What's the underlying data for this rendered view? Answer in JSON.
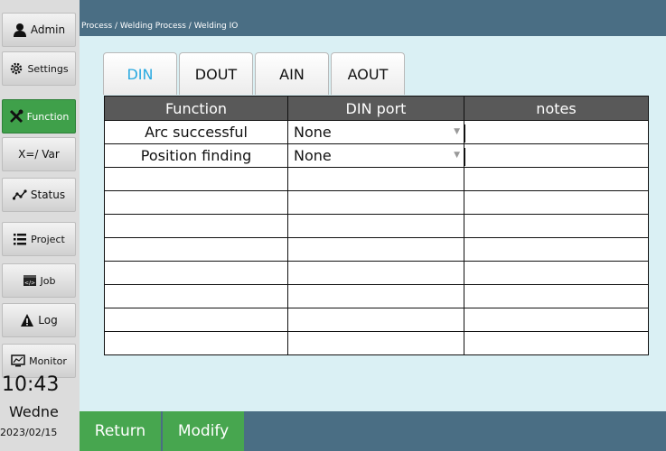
{
  "sidebar": {
    "items": [
      {
        "label": "Admin",
        "icon": "user-icon"
      },
      {
        "label": "Settings",
        "icon": "gear-icon"
      },
      {
        "label": "Function",
        "icon": "tools-icon"
      },
      {
        "label": "X=/ Var",
        "icon": ""
      },
      {
        "label": "Status",
        "icon": "waveform-icon"
      },
      {
        "label": "Project",
        "icon": "list-icon"
      },
      {
        "label": "Job",
        "icon": "code-icon"
      },
      {
        "label": "Log",
        "icon": "warning-icon"
      },
      {
        "label": "Monitor",
        "icon": "monitor-icon"
      }
    ],
    "time": "10:43",
    "day": "Wedne",
    "date": "2023/02/15"
  },
  "header": {
    "breadcrumb": "Process / Welding Process / Welding IO"
  },
  "tabs": [
    "DIN",
    "DOUT",
    "AIN",
    "AOUT"
  ],
  "active_tab": "DIN",
  "table": {
    "headers": [
      "Function",
      "DIN port",
      "notes"
    ],
    "rows": [
      [
        "Arc successful",
        "None",
        ""
      ],
      [
        "Position finding",
        "None",
        ""
      ],
      [
        "",
        "",
        ""
      ],
      [
        "",
        "",
        ""
      ],
      [
        "",
        "",
        ""
      ],
      [
        "",
        "",
        ""
      ],
      [
        "",
        "",
        ""
      ],
      [
        "",
        "",
        ""
      ],
      [
        "",
        "",
        ""
      ],
      [
        "",
        "",
        ""
      ]
    ]
  },
  "bottom": {
    "return_label": "Return",
    "modify_label": "Modify"
  },
  "colors": {
    "accent_green": "#3fa04a",
    "header_blue": "#4a6e84",
    "tab_active": "#29a9e0"
  }
}
